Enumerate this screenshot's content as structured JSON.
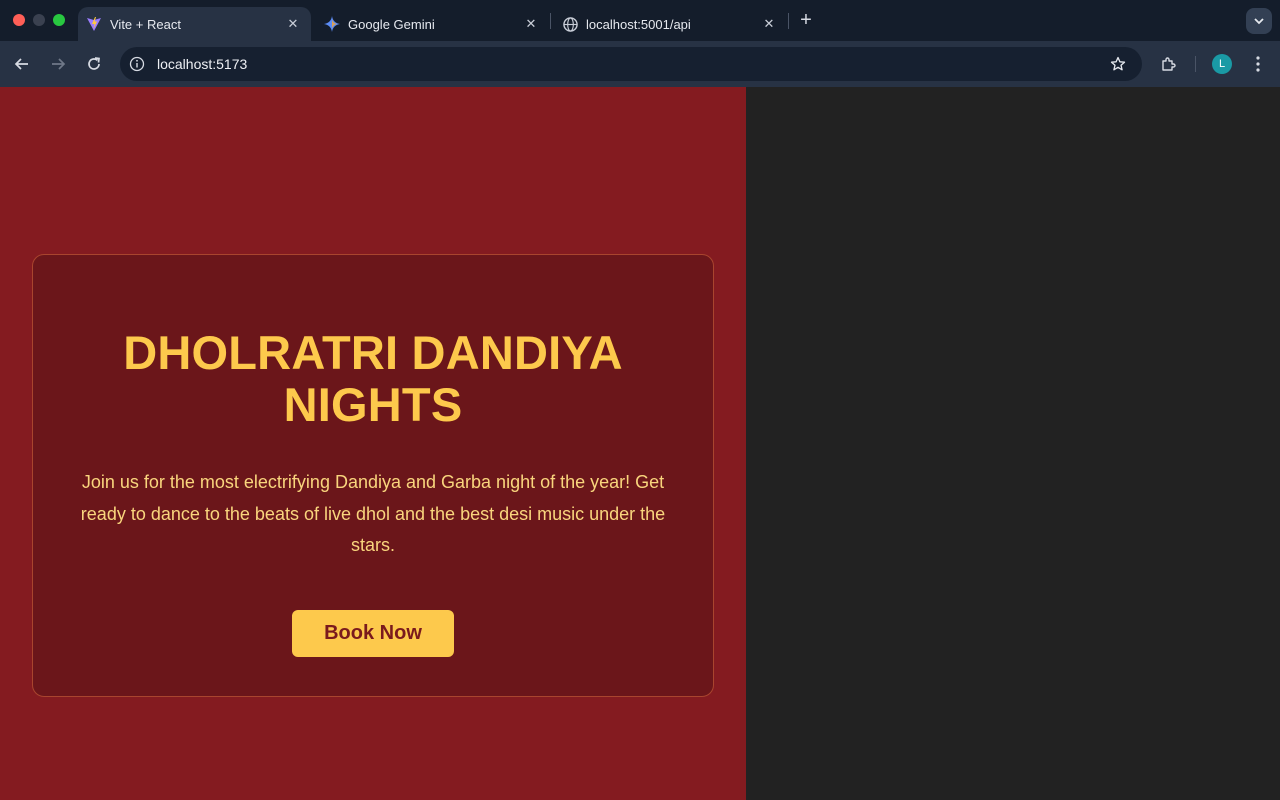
{
  "browser": {
    "tabs": [
      {
        "title": "Vite + React",
        "icon": "vite-logo-icon",
        "active": true
      },
      {
        "title": "Google Gemini",
        "icon": "gemini-sparkle-icon",
        "active": false
      },
      {
        "title": "localhost:5001/api",
        "icon": "globe-icon",
        "active": false
      }
    ],
    "address": "localhost:5173",
    "profile_initial": "L",
    "colors": {
      "tabstrip": "#141d2b",
      "toolbar": "#273244",
      "omnibox": "#162030",
      "avatar": "#1a9aa5"
    }
  },
  "page": {
    "headline": "DHOLRATRI DANDIYA NIGHTS",
    "description": "Join us for the most electrifying Dandiya and Garba night of the year! Get ready to dance to the beats of live dhol and the best desi music under the stars.",
    "cta_label": "Book Now",
    "colors": {
      "hero_bg": "#841b20",
      "card_bg": "#6b161a",
      "accent": "#fdc94c",
      "text": "#f9d57d",
      "right_panel": "#222222"
    }
  }
}
